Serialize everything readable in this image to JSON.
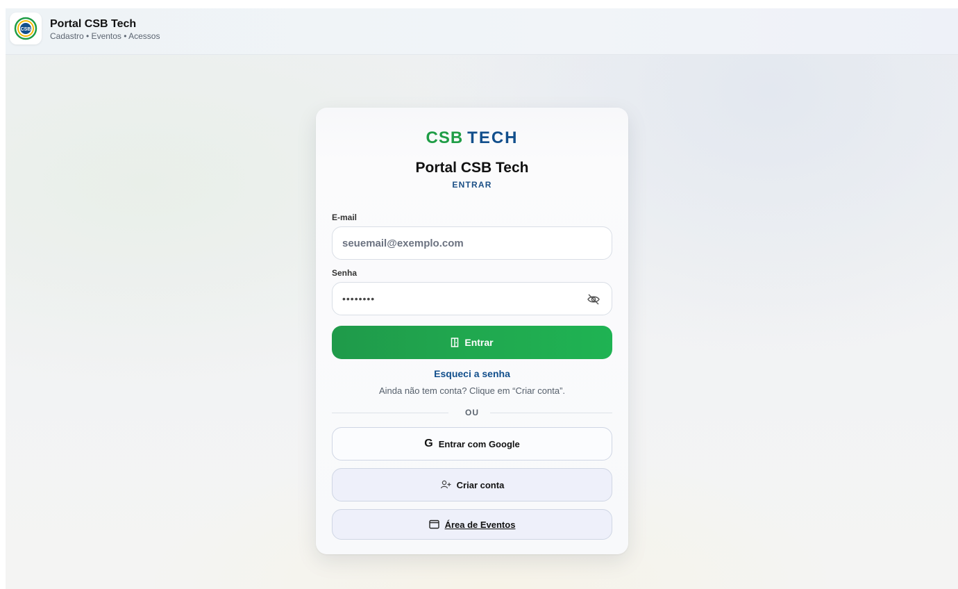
{
  "header": {
    "title": "Portal CSB Tech",
    "subtitle": "Cadastro • Eventos • Acessos",
    "logo_text": "CSB"
  },
  "card": {
    "brand_left": "CSB",
    "brand_right": "TECH",
    "title": "Portal CSB Tech",
    "mode": "ENTRAR"
  },
  "form": {
    "email_label": "E-mail",
    "email_placeholder": "seuemail@exemplo.com",
    "password_label": "Senha",
    "password_value": "••••••••",
    "submit_label": "Entrar"
  },
  "links": {
    "forgot": "Esqueci a senha",
    "hint": "Ainda não tem conta? Clique em “Criar conta”.",
    "divider": "OU"
  },
  "buttons": {
    "google": "Entrar com Google",
    "create": "Criar conta",
    "events": "Área de Eventos"
  },
  "colors": {
    "brand_green": "#1f9d46",
    "brand_blue": "#124f8c",
    "primary_button": "#20a84f"
  },
  "icons": {
    "password_toggle": "eye-off-icon",
    "submit": "door-icon",
    "google": "google-icon",
    "create": "user-plus-icon",
    "events": "calendar-icon"
  }
}
